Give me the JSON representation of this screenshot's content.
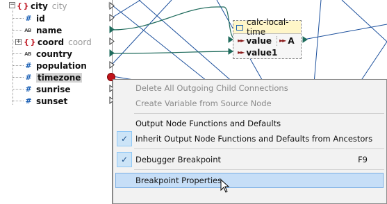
{
  "tree": {
    "root": {
      "label": "city",
      "sub": "city"
    },
    "nodes": [
      {
        "label": "id",
        "icon": "#",
        "sub": ""
      },
      {
        "label": "name",
        "icon": "AB",
        "sub": ""
      },
      {
        "label": "coord",
        "icon": "{ }",
        "sub": "coord"
      },
      {
        "label": "country",
        "icon": "AB",
        "sub": ""
      },
      {
        "label": "population",
        "icon": "#",
        "sub": ""
      },
      {
        "label": "timezone",
        "icon": "#",
        "sub": ""
      },
      {
        "label": "sunrise",
        "icon": "#",
        "sub": ""
      },
      {
        "label": "sunset",
        "icon": "#",
        "sub": ""
      }
    ]
  },
  "function": {
    "title": "calc-local-time",
    "inputs": [
      "value",
      "value1"
    ],
    "output": "A"
  },
  "menu": {
    "items": [
      {
        "label": "Delete All Outgoing Child Connections",
        "disabled": true
      },
      {
        "label": "Create Variable from Source Node",
        "disabled": true
      },
      {
        "label": "Output Node Functions and Defaults"
      },
      {
        "label": "Inherit Output Node Functions and Defaults from Ancestors",
        "checked": true
      },
      {
        "label": "Debugger Breakpoint",
        "shortcut": "F9",
        "checked": true
      },
      {
        "label": "Breakpoint Properties",
        "highlighted": true
      }
    ]
  },
  "colors": {
    "breakpoint": "#c0141b",
    "highlight": "#c6def7",
    "connector_green": "#1f6b5c",
    "function_header": "#fff6c8"
  }
}
